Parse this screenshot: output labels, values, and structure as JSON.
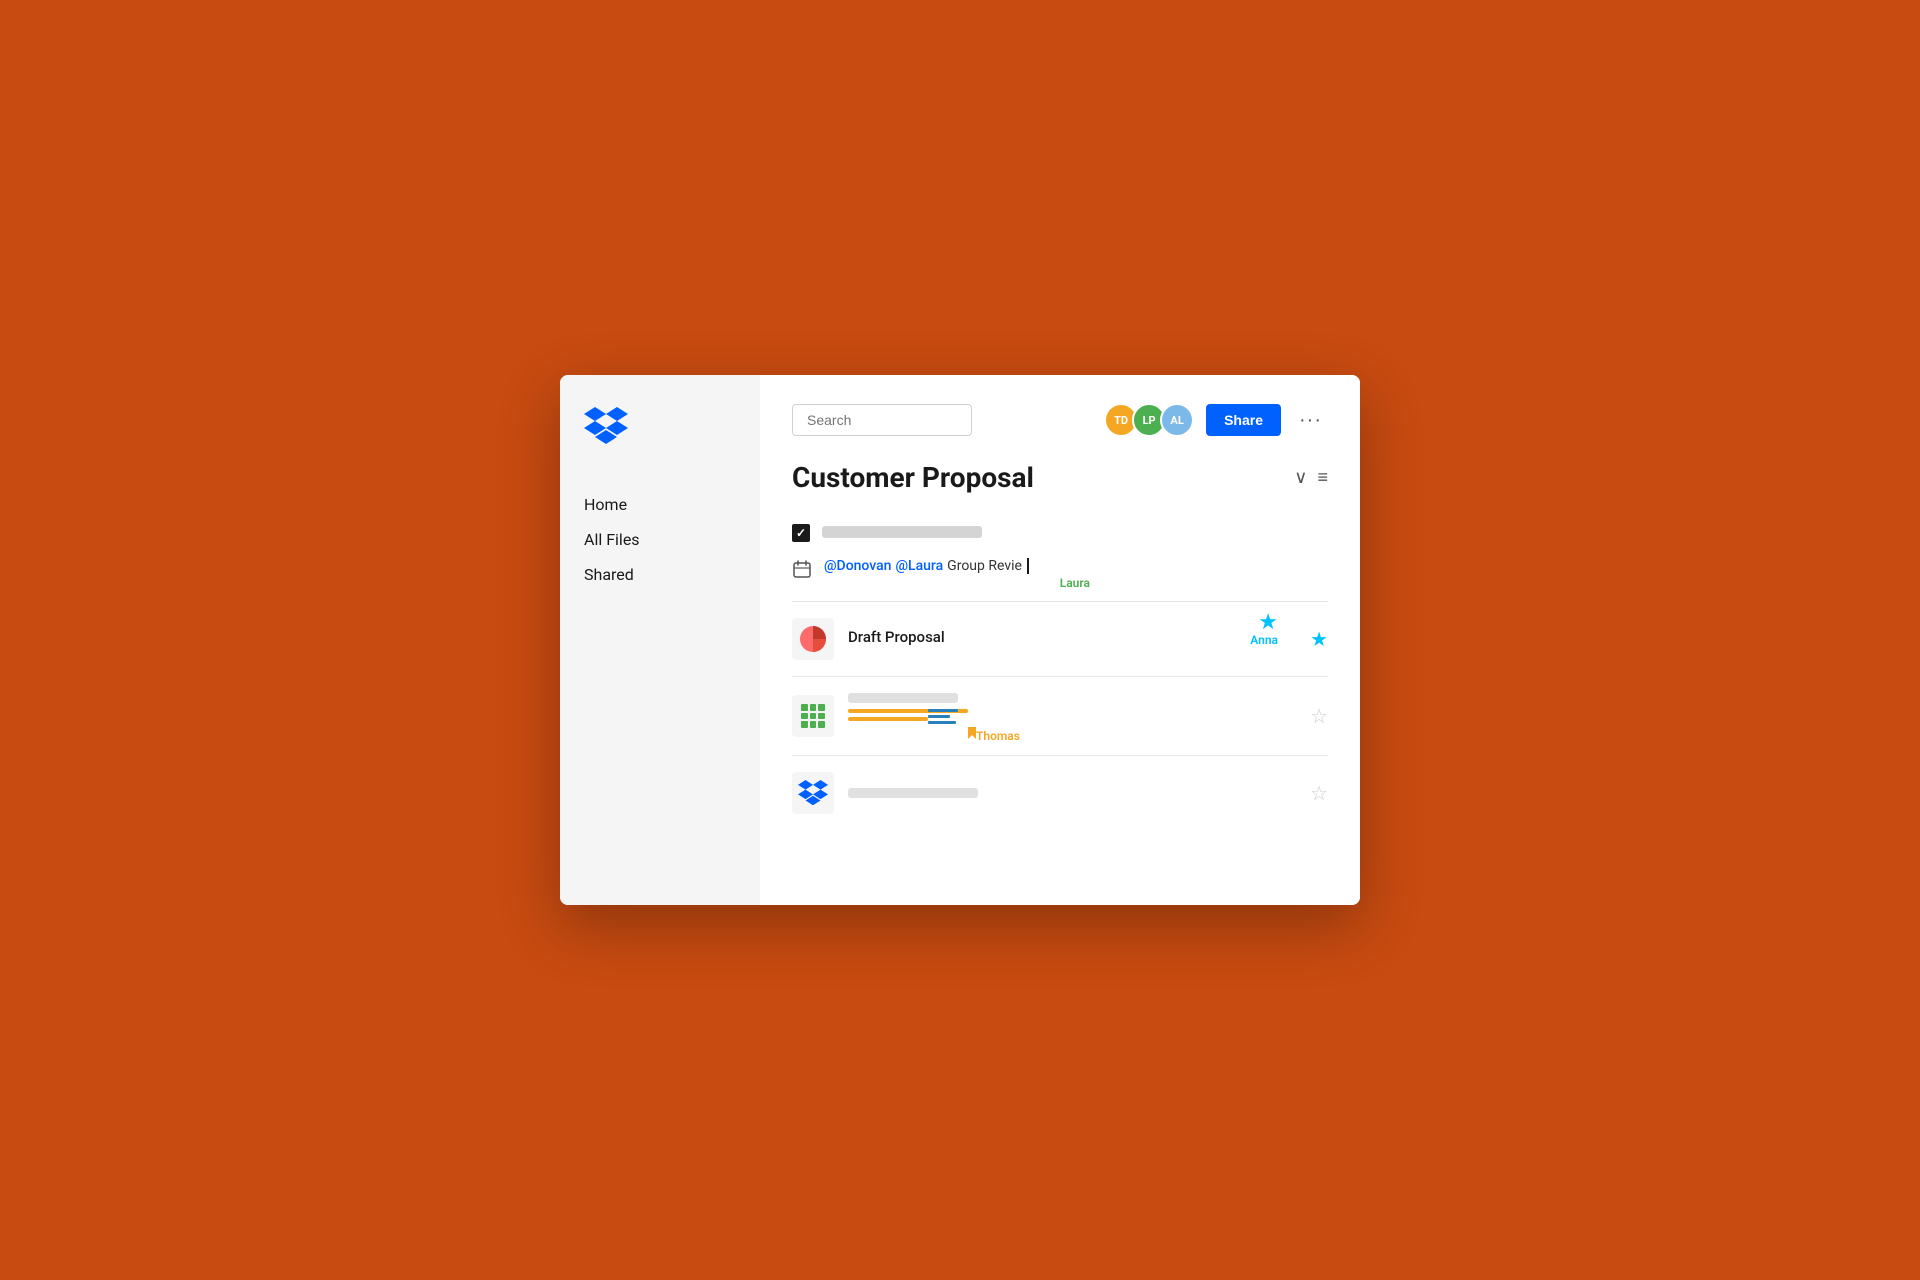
{
  "background_color": "#C84B11",
  "sidebar": {
    "nav_items": [
      {
        "id": "home",
        "label": "Home"
      },
      {
        "id": "all-files",
        "label": "All Files"
      },
      {
        "id": "shared",
        "label": "Shared"
      }
    ]
  },
  "header": {
    "search_placeholder": "Search",
    "avatars": [
      {
        "id": "td",
        "initials": "TD",
        "color": "#F5A623"
      },
      {
        "id": "lp",
        "initials": "LP",
        "color": "#4CAF50"
      },
      {
        "id": "al",
        "initials": "AL",
        "color": "#7CB9E8"
      }
    ],
    "share_button_label": "Share",
    "more_button_label": "···"
  },
  "document": {
    "title": "Customer Proposal",
    "collapse_icon": "∨",
    "menu_icon": "≡"
  },
  "tasks": [
    {
      "id": "task-1",
      "checked": true,
      "type": "checkbox"
    },
    {
      "id": "task-2",
      "type": "calendar",
      "mention_1": "@Donovan",
      "mention_2": "@Laura",
      "text": "Group Revie",
      "collaborator": "Laura",
      "collaborator_color": "#4CAF50"
    }
  ],
  "files": [
    {
      "id": "file-1",
      "name": "Draft Proposal",
      "icon_type": "pie",
      "starred": true,
      "collaborator": "Anna",
      "collaborator_color": "#00C2FF"
    },
    {
      "id": "file-2",
      "name": "",
      "icon_type": "grid",
      "starred": false,
      "collaborator": "Thomas",
      "collaborator_color": "#F5A623"
    },
    {
      "id": "file-3",
      "name": "",
      "icon_type": "dropbox",
      "starred": false
    }
  ]
}
